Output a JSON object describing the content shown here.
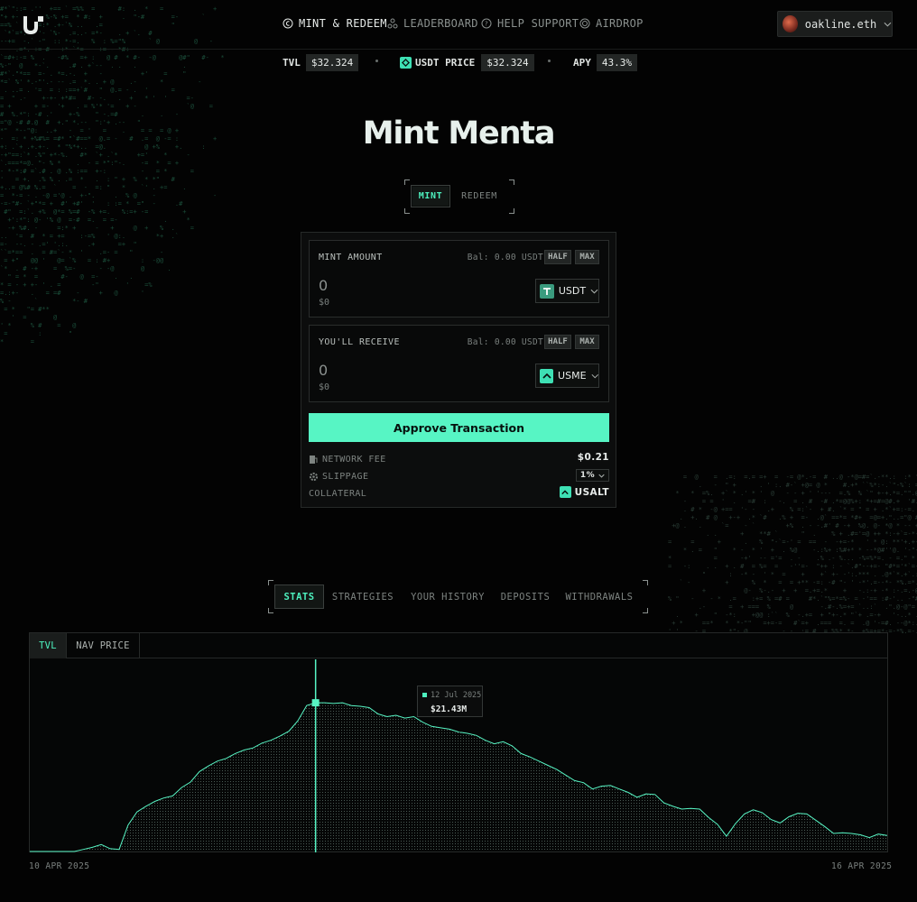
{
  "nav": {
    "items": [
      {
        "label": "MINT & REDEEM",
        "icon": "mint-icon"
      },
      {
        "label": "LEADERBOARD",
        "icon": "leaderboard-icon"
      },
      {
        "label": "HELP SUPPORT",
        "icon": "help-icon"
      },
      {
        "label": "AIRDROP",
        "icon": "airdrop-icon"
      }
    ],
    "wallet": "oakline.eth"
  },
  "stats_bar": {
    "tvl_label": "TVL",
    "tvl_value": "$32.324",
    "usdt_label": "USDT PRICE",
    "usdt_value": "$32.324",
    "apy_label": "APY",
    "apy_value": "43.3%"
  },
  "hero": {
    "title": "Mint Menta"
  },
  "toggle": {
    "mint": "MINT",
    "redeem": "REDEEM"
  },
  "mint_panel": {
    "label": "MINT AMOUNT",
    "balance": "Bal: 0.00 USDT",
    "half": "HALF",
    "max": "MAX",
    "amount": "0",
    "usd": "$0",
    "token": "USDT"
  },
  "receive_panel": {
    "label": "YOU'LL RECEIVE",
    "balance": "Bal: 0.00 USDT",
    "half": "HALF",
    "max": "MAX",
    "amount": "0",
    "usd": "$0",
    "token": "USME"
  },
  "approve_label": "Approve Transaction",
  "details": {
    "fee_label": "NETWORK FEE",
    "fee_value": "$0.21",
    "slippage_label": "SLIPPAGE",
    "slippage_value": "1%",
    "collateral_label": "COLLATERAL",
    "collateral_value": "USALT"
  },
  "tabs": [
    "STATS",
    "STRATEGIES",
    "YOUR HISTORY",
    "DEPOSITS",
    "WITHDRAWALS"
  ],
  "chart_tabs": [
    "TVL",
    "NAV PRICE"
  ],
  "colors": {
    "accent": "#57f5c4",
    "background": "#030303"
  },
  "chart_data": {
    "type": "area",
    "x_start_label": "10 APR 2025",
    "x_end_label": "16 APR 2025",
    "tooltip": {
      "date": "12 Jul 2025",
      "value": "$21.43M"
    },
    "values": [
      0,
      0,
      0,
      0,
      0,
      0,
      0.3,
      0.6,
      1.0,
      0.4,
      0.3,
      3.8,
      5.7,
      6.5,
      7.2,
      7.7,
      8.0,
      9.2,
      10.0,
      11.5,
      12.3,
      13.0,
      13.4,
      14.1,
      14.6,
      14.9,
      15.6,
      16.0,
      16.6,
      17.3,
      18.8,
      21.0,
      21.4,
      21.4,
      21.3,
      21.4,
      21.0,
      20.9,
      20.7,
      19.8,
      19.4,
      19.6,
      19.2,
      19.4,
      18.6,
      18.0,
      17.8,
      17.6,
      17.2,
      17.0,
      16.7,
      16.0,
      15.5,
      15.8,
      15.2,
      14.1,
      13.6,
      13.0,
      12.4,
      11.8,
      11.0,
      10.2,
      9.9,
      9.0,
      9.4,
      9.5,
      9.0,
      8.5,
      7.8,
      8.3,
      8.2,
      7.0,
      6.5,
      6.1,
      6.2,
      6.1,
      4.9,
      3.9,
      2.2,
      4.0,
      5.4,
      6.0,
      5.6,
      4.6,
      4.1,
      5.0,
      5.5,
      5.4,
      4.5,
      3.6,
      2.6,
      2.7,
      2.6,
      2.4,
      2.0,
      2.5,
      2.3
    ]
  }
}
